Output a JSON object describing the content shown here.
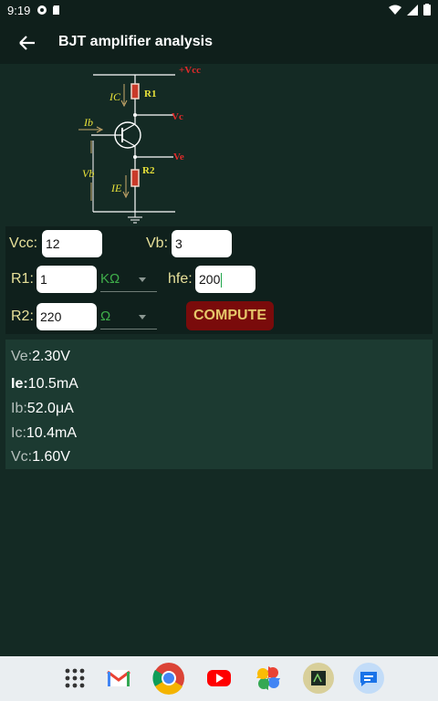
{
  "status": {
    "time": "9:19"
  },
  "appbar": {
    "title": "BJT amplifier analysis"
  },
  "circuit": {
    "labels": {
      "vcc": "+Vcc",
      "r1": "R1",
      "r2": "R2",
      "vc": "Vc",
      "ve": "Ve",
      "ic": "IC",
      "ib": "Ib",
      "vb": "Vb",
      "ie": "IE"
    }
  },
  "inputs": {
    "vcc_label": "Vcc:",
    "vcc_value": "12",
    "vb_label": "Vb:",
    "vb_value": "3",
    "r1_label": "R1:",
    "r1_value": "1",
    "r1_unit": "KΩ",
    "hfe_label": "hfe:",
    "hfe_value": "200",
    "r2_label": "R2:",
    "r2_value": "220",
    "r2_unit": "Ω",
    "compute_label": "COMPUTE"
  },
  "results": [
    {
      "key": "Ve:",
      "value": "2.30V"
    },
    {
      "key": "Ie:",
      "value": "10.5mA"
    },
    {
      "key": "Ib:",
      "value": "52.0μA"
    },
    {
      "key": "Ic:",
      "value": "10.4mA"
    },
    {
      "key": "Vc:",
      "value": "1.60V"
    }
  ],
  "colors": {
    "background": "#142a24",
    "label": "#e7e09a",
    "compute_bg": "#7a0b0b",
    "compute_text": "#e6c76a"
  },
  "dock": [
    "app-drawer-icon",
    "gmail-icon",
    "chrome-icon",
    "youtube-icon",
    "photos-icon",
    "circuit-app-icon",
    "messages-icon"
  ]
}
